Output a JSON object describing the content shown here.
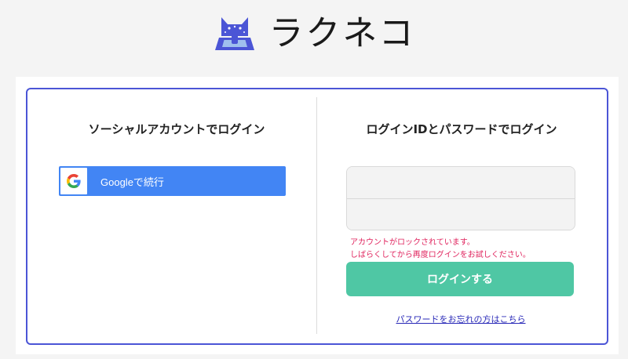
{
  "header": {
    "brand": "ラクネコ",
    "logo_icon": "cat-laptop-icon",
    "logo_color": "#4b55d6"
  },
  "social": {
    "title": "ソーシャルアカウントでログイン",
    "google_button_label": "Googleで続行",
    "google_icon": "google-g-icon",
    "google_button_color": "#4285f4"
  },
  "credentials": {
    "title": "ログインIDとパスワードでログイン",
    "login_id_value": "",
    "password_value": "",
    "error_lines": [
      "アカウントがロックされています。",
      "しばらくしてから再度ログインをお試しください。"
    ],
    "error_color": "#e0245e",
    "login_button_label": "ログインする",
    "login_button_color": "#4fc7a4",
    "forgot_password_link": "パスワードをお忘れの方はこちら"
  }
}
